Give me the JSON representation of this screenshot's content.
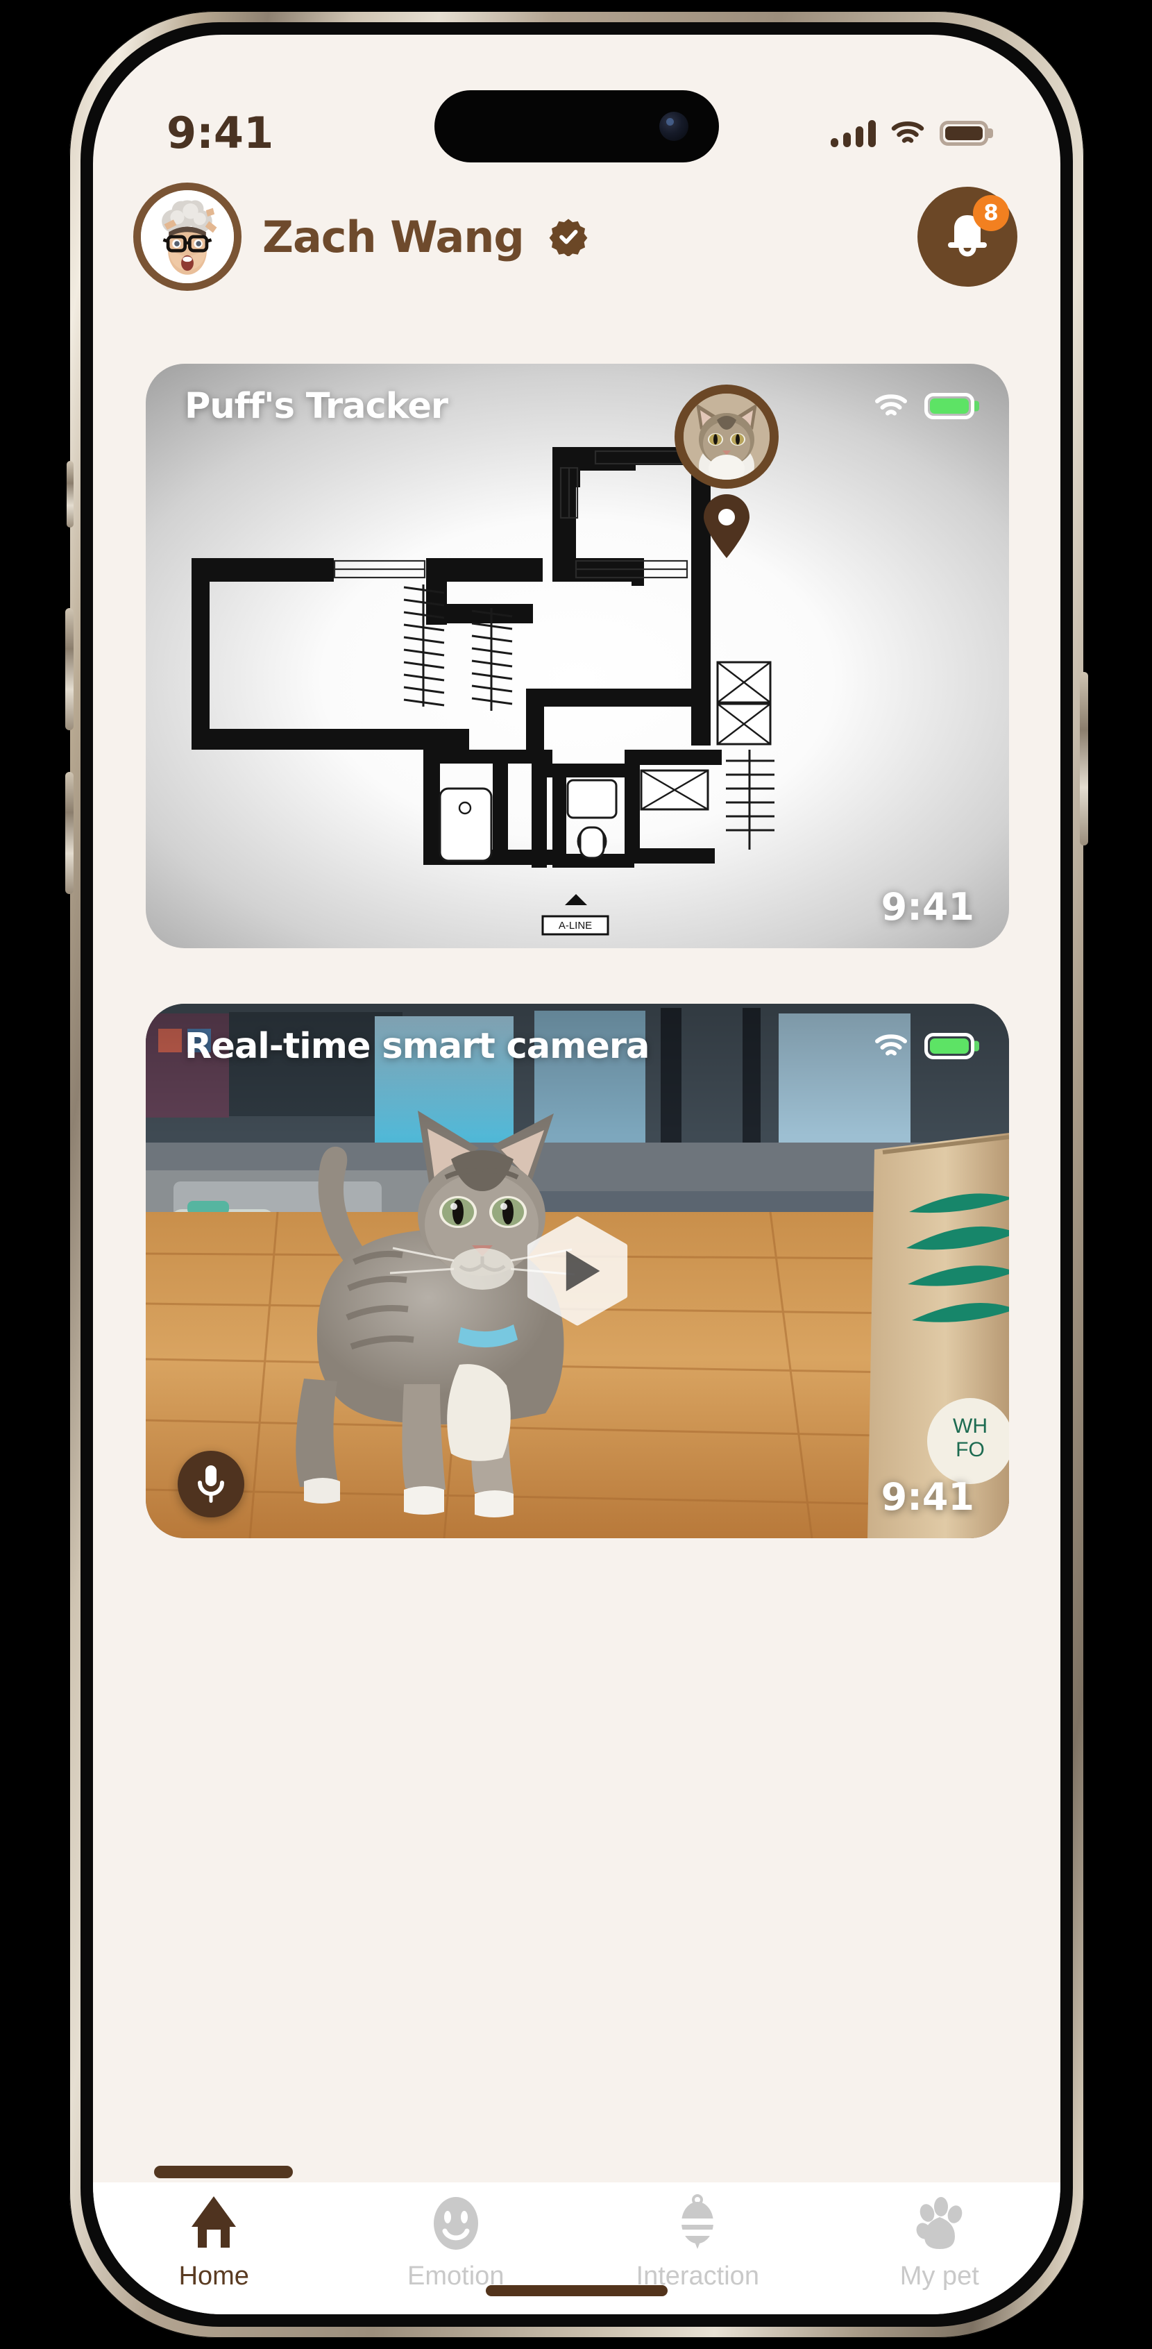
{
  "status_bar": {
    "time": "9:41",
    "signal_icon": "cellular-signal-icon",
    "wifi_icon": "wifi-icon",
    "battery_icon": "battery-icon"
  },
  "header": {
    "avatar_name": "user-avatar-memoji",
    "username": "Zach Wang",
    "verified_icon": "verified-badge-icon",
    "bell_icon": "bell-icon",
    "notification_count": "8"
  },
  "cards": {
    "tracker": {
      "title": "Puff's Tracker",
      "wifi_icon": "wifi-icon",
      "battery_icon": "battery-icon",
      "timestamp": "9:41",
      "pet_avatar": "pet-photo-puff",
      "pin_icon": "map-pin-icon"
    },
    "camera": {
      "title": "Real-time smart camera",
      "wifi_icon": "wifi-icon",
      "battery_icon": "battery-icon",
      "timestamp": "9:41",
      "play_icon": "play-icon",
      "mic_icon": "microphone-icon"
    }
  },
  "tabbar": {
    "items": [
      {
        "label": "Home",
        "icon": "home-icon",
        "active": true
      },
      {
        "label": "Emotion",
        "icon": "smiley-face-icon",
        "active": false
      },
      {
        "label": "Interaction",
        "icon": "pet-toy-icon",
        "active": false
      },
      {
        "label": "My pet",
        "icon": "paw-print-icon",
        "active": false
      }
    ]
  },
  "colors": {
    "brand_brown": "#6b4726",
    "text_brown": "#4a3322",
    "accent_orange": "#f28020",
    "battery_green": "#5de365",
    "background": "#f7f2ed",
    "tab_inactive": "#c9c9c9"
  }
}
